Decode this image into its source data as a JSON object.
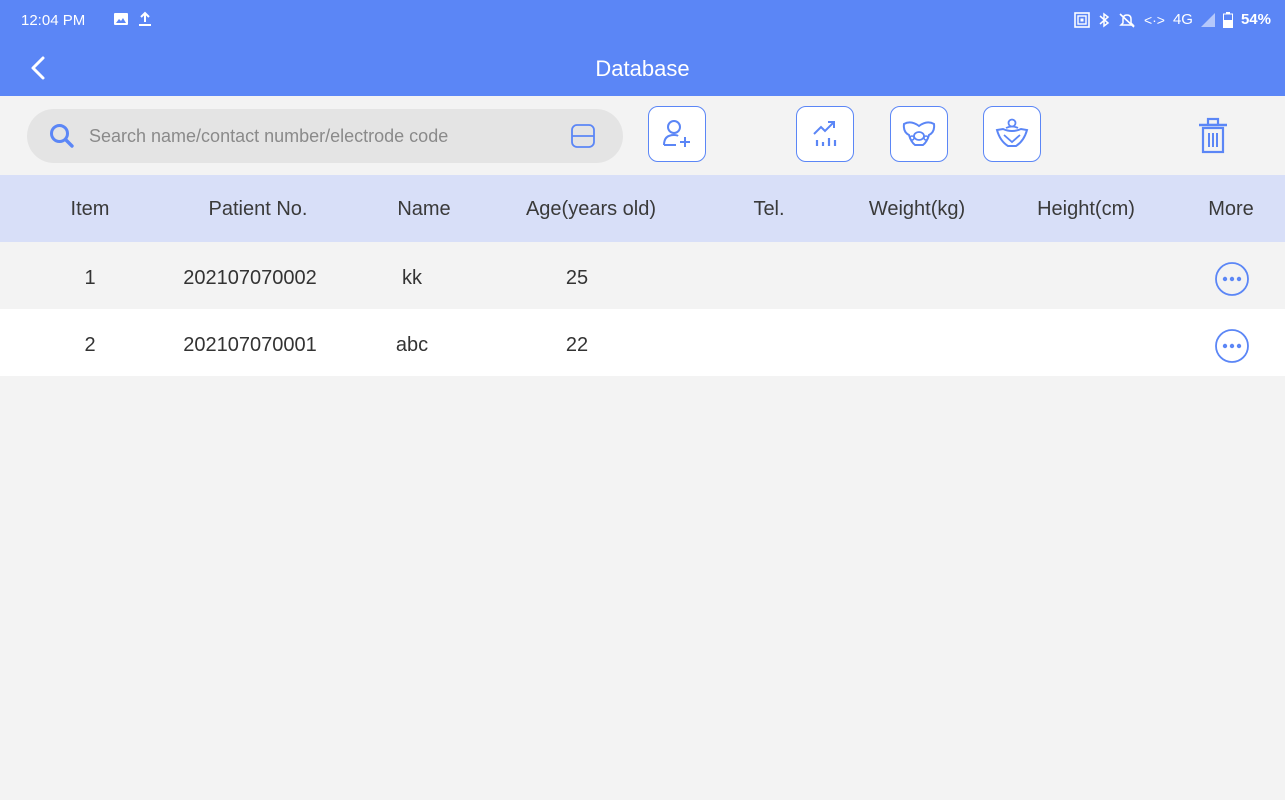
{
  "status": {
    "time": "12:04 PM",
    "network": "4G",
    "battery": "54%",
    "left_icons": [
      "image-icon",
      "upload-icon"
    ],
    "right_icons": [
      "screen-record-icon",
      "bluetooth-icon",
      "mute-icon",
      "signal-icon",
      "battery-icon"
    ]
  },
  "appbar": {
    "title": "Database",
    "back_icon": "back-chevron-icon"
  },
  "search": {
    "placeholder": "Search name/contact number/electrode code",
    "value": ""
  },
  "toolbar": {
    "buttons": [
      {
        "name": "add-patient-button",
        "icon": "add-user-icon"
      },
      {
        "name": "statistics-button",
        "icon": "chart-icon"
      },
      {
        "name": "pelvis-button",
        "icon": "pelvis-icon"
      },
      {
        "name": "pelvic-floor-button",
        "icon": "pelvic-floor-icon"
      },
      {
        "name": "delete-button",
        "icon": "trash-icon"
      }
    ],
    "accent": "#5b86f6"
  },
  "table": {
    "headers": [
      "Item",
      "Patient No.",
      "Name",
      "Age(years old)",
      "Tel.",
      "Weight(kg)",
      "Height(cm)",
      "More"
    ],
    "rows": [
      {
        "item": "1",
        "patient_no": "202107070002",
        "name": "kk",
        "age": "25",
        "tel": "",
        "weight": "",
        "height": ""
      },
      {
        "item": "2",
        "patient_no": "202107070001",
        "name": "abc",
        "age": "22",
        "tel": "",
        "weight": "",
        "height": ""
      }
    ]
  },
  "colors": {
    "primary": "#5b86f6",
    "header_bg": "#d8dff8",
    "background": "#f3f3f3"
  }
}
